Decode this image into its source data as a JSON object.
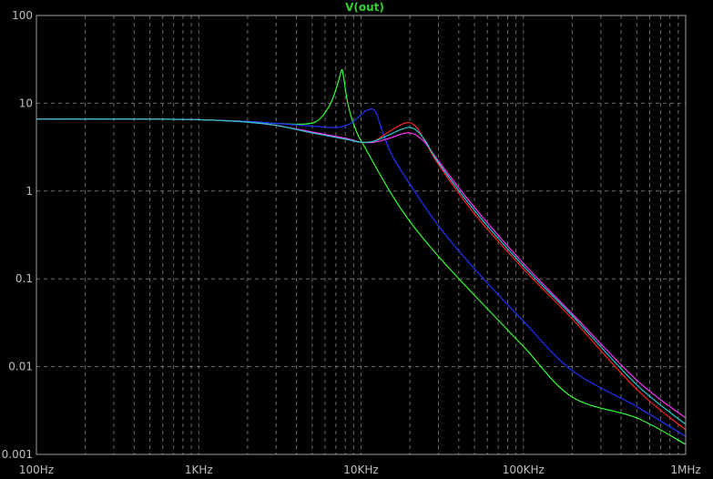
{
  "chart_data": {
    "type": "line",
    "title": "V(out)",
    "x_scale": "log",
    "y_scale": "log",
    "xlim": [
      100,
      1000000
    ],
    "ylim": [
      0.001,
      100
    ],
    "grid": true,
    "x_tick_labels": [
      "100Hz",
      "1KHz",
      "10KHz",
      "100KHz",
      "1MHz"
    ],
    "y_tick_labels": [
      "100",
      "10",
      "1",
      "0.1",
      "0.01",
      "0.001"
    ],
    "colors": {
      "background": "#000000",
      "axis": "#a0a0a0",
      "grid": "#6e6e6e",
      "title": "#2fd12f"
    },
    "series": [
      {
        "color": "#33ff33",
        "x": [
          100,
          500,
          1000,
          2000,
          3000,
          4500,
          5500,
          6500,
          7200,
          7600,
          7800,
          8200,
          8700,
          9500,
          10500,
          15000,
          20000,
          30000,
          50000,
          100000,
          200000,
          500000,
          1000000
        ],
        "y": [
          6.6,
          6.6,
          6.5,
          6.2,
          5.9,
          5.8,
          6.5,
          10.0,
          17.0,
          24.0,
          20.0,
          11.0,
          7.0,
          4.5,
          3.2,
          1.0,
          0.45,
          0.18,
          0.065,
          0.017,
          0.0045,
          0.0026,
          0.0013
        ]
      },
      {
        "color": "#2233ff",
        "x": [
          100,
          500,
          1000,
          2000,
          3000,
          5000,
          7000,
          8500,
          9500,
          10500,
          11500,
          12000,
          12500,
          14000,
          16000,
          20000,
          30000,
          50000,
          100000,
          200000,
          500000,
          1000000
        ],
        "y": [
          6.6,
          6.6,
          6.5,
          6.2,
          5.9,
          5.5,
          5.3,
          5.8,
          6.8,
          8.0,
          8.6,
          8.4,
          7.5,
          4.0,
          2.3,
          1.2,
          0.4,
          0.13,
          0.033,
          0.009,
          0.0035,
          0.0016
        ]
      },
      {
        "color": "#ff2222",
        "x": [
          100,
          500,
          1000,
          2000,
          3000,
          5000,
          8000,
          10000,
          12000,
          15000,
          18000,
          20000,
          22000,
          25000,
          30000,
          50000,
          100000,
          200000,
          500000,
          1000000
        ],
        "y": [
          6.6,
          6.6,
          6.5,
          6.1,
          5.6,
          4.6,
          3.9,
          3.6,
          3.7,
          4.8,
          5.8,
          6.0,
          5.3,
          3.6,
          2.0,
          0.55,
          0.13,
          0.035,
          0.0055,
          0.0019
        ]
      },
      {
        "color": "#ff33ff",
        "x": [
          100,
          500,
          1000,
          2000,
          3000,
          5000,
          8000,
          10000,
          12000,
          15000,
          18000,
          20000,
          22000,
          25000,
          30000,
          50000,
          100000,
          200000,
          500000,
          1000000
        ],
        "y": [
          6.6,
          6.6,
          6.5,
          6.1,
          5.6,
          4.7,
          4.0,
          3.6,
          3.6,
          4.0,
          4.5,
          4.6,
          4.3,
          3.5,
          2.2,
          0.65,
          0.15,
          0.04,
          0.007,
          0.0026
        ]
      },
      {
        "color": "#22cccc",
        "x": [
          100,
          500,
          1000,
          2000,
          3000,
          5000,
          8000,
          10000,
          12000,
          15000,
          18000,
          20000,
          22000,
          25000,
          30000,
          50000,
          100000,
          200000,
          500000,
          1000000
        ],
        "y": [
          6.6,
          6.6,
          6.5,
          6.1,
          5.6,
          4.6,
          3.9,
          3.6,
          3.7,
          4.4,
          5.1,
          5.3,
          4.9,
          3.7,
          2.1,
          0.6,
          0.14,
          0.038,
          0.0062,
          0.0022
        ]
      }
    ]
  }
}
